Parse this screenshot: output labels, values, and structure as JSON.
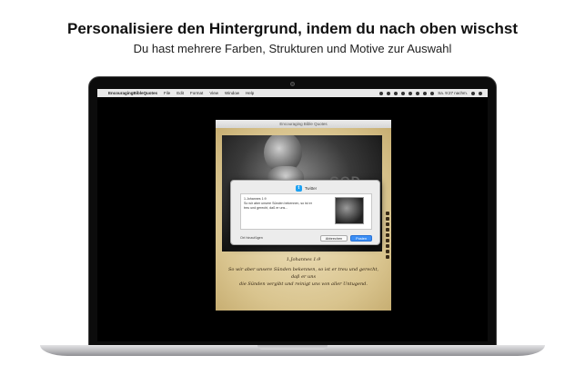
{
  "promo": {
    "headline": "Personalisiere den Hintergrund, indem du nach oben wischst",
    "subline": "Du hast mehrere Farben, Strukturen und Motive zur Auswahl"
  },
  "menubar": {
    "apple": "",
    "app_name": "EncouragingBibleQuotes",
    "items": [
      "File",
      "Edit",
      "Format",
      "View",
      "Window",
      "Help"
    ],
    "clock": "Sa. 9:27 nachm."
  },
  "app_window": {
    "title": "Encouraging Bible Quotes",
    "photo_faint_1": "GOD",
    "photo_faint_2": "er",
    "verse_ref": "1.Johannes 1:9",
    "verse_line1": "So wir aber unsere Sünden bekennen, so ist er treu und gerecht, daß er uns",
    "verse_line2": "die Sünden vergibt und reinigt uns von aller Untugend."
  },
  "share_dialog": {
    "service": "Twitter",
    "service_icon": "twitter-icon",
    "text_line1": "1.Johannes 1:9",
    "text_line2": "So wir aber unsere Sünden bekennen, so ist er",
    "text_line3": "treu und gerecht, daß er uns...",
    "location_label": "Ort hinzufügen",
    "cancel_label": "Abbrechen",
    "post_label": "Posten",
    "accent": "#3b8ef5"
  }
}
